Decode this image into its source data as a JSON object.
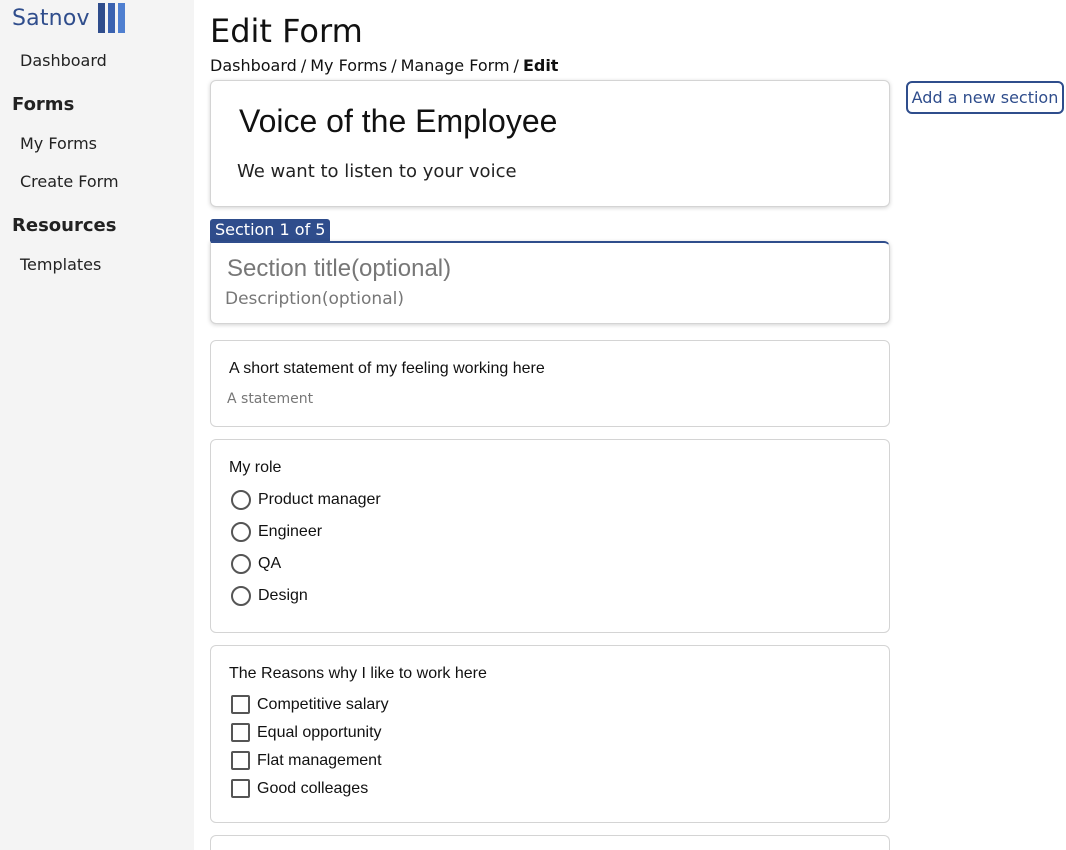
{
  "brand": {
    "name": "Satnov",
    "colors": {
      "logo_bar_1": "#2f4d8c",
      "logo_bar_2": "#3a62b0",
      "logo_bar_3": "#4f7fd0"
    }
  },
  "sidebar": {
    "dashboard": "Dashboard",
    "forms_heading": "Forms",
    "my_forms": "My Forms",
    "create_form": "Create Form",
    "resources_heading": "Resources",
    "templates": "Templates"
  },
  "header": {
    "title": "Edit Form",
    "breadcrumb": [
      "Dashboard",
      "My Forms",
      "Manage Form",
      "Edit"
    ],
    "separator": "/"
  },
  "actions": {
    "add_section": "Add a new section"
  },
  "form": {
    "title": "Voice of the Employee",
    "description": "We want to listen to your voice"
  },
  "section": {
    "tab_label": "Section 1 of 5",
    "title_placeholder": "Section title(optional)",
    "description_placeholder": "Description(optional)"
  },
  "questions": [
    {
      "label": "A short statement of my feeling working here",
      "placeholder": "A statement"
    },
    {
      "label": "My role",
      "options": [
        "Product manager",
        "Engineer",
        "QA",
        "Design"
      ]
    },
    {
      "label": "The Reasons why I like to work here",
      "options": [
        "Competitive salary",
        "Equal opportunity",
        "Flat management",
        "Good colleages"
      ]
    }
  ],
  "theme": {
    "accent": "#2f4d8c",
    "sidebar_bg": "#f4f4f4"
  }
}
